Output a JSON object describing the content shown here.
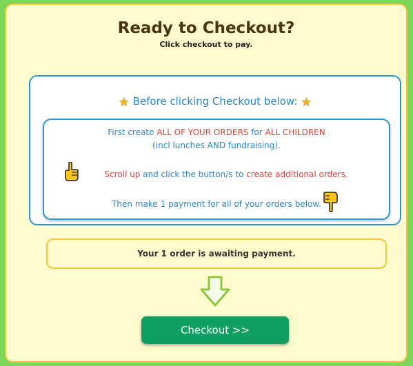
{
  "header": {
    "title": "Ready to Checkout?",
    "subtitle": "Click checkout to pay."
  },
  "info": {
    "heading": "Before clicking Checkout below:",
    "star_icon": "★",
    "line1_a": "First create ",
    "line1_b": "ALL OF YOUR ORDERS",
    "line1_c": " for ",
    "line1_d": "ALL CHILDREN",
    "line2": "(incl lunches AND fundraising).",
    "line3_a": "Scroll up",
    "line3_b": " and click the button/s to ",
    "line3_c": "create additional orders.",
    "line4": "Then make 1 payment for all of your orders below."
  },
  "status": {
    "text": "Your 1 order is awaiting payment."
  },
  "checkout": {
    "label": "Checkout >>"
  },
  "colors": {
    "page_bg": "#7cd65a",
    "panel_bg": "#fffbcc",
    "blue": "#2a86c8",
    "red": "#d8433b",
    "button_green": "#0f9f63"
  }
}
